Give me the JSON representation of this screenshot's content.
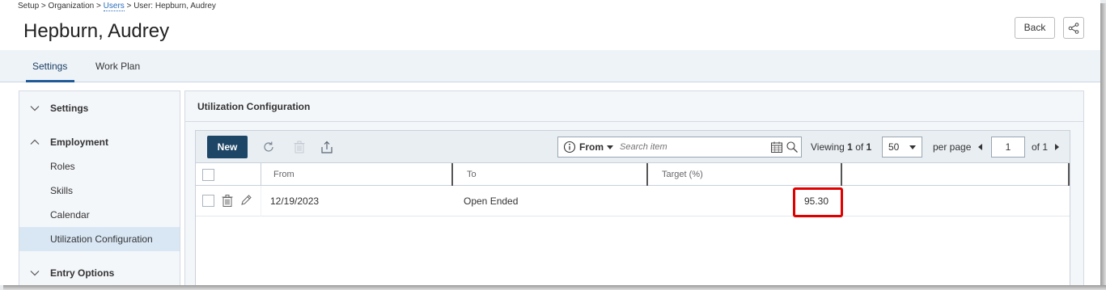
{
  "breadcrumb": {
    "setup": "Setup",
    "sep1": " > ",
    "organization": "Organization",
    "sep2": " > ",
    "users": "Users",
    "sep3": " > ",
    "user": "User: Hepburn, Audrey"
  },
  "page_title": "Hepburn, Audrey",
  "header_actions": {
    "back_label": "Back",
    "share_icon": "share-icon"
  },
  "tabs": [
    {
      "label": "Settings",
      "active": true
    },
    {
      "label": "Work Plan",
      "active": false
    }
  ],
  "sidebar": {
    "sections": [
      {
        "label": "Settings",
        "expanded": false
      },
      {
        "label": "Employment",
        "expanded": true
      },
      {
        "label": "Entry Options",
        "expanded": false
      }
    ],
    "employment_items": [
      {
        "label": "Roles",
        "active": false
      },
      {
        "label": "Skills",
        "active": false
      },
      {
        "label": "Calendar",
        "active": false
      },
      {
        "label": "Utilization Configuration",
        "active": true
      }
    ]
  },
  "panel": {
    "title": "Utilization Configuration"
  },
  "grid": {
    "toolbar": {
      "new_label": "New",
      "search_field": "From",
      "search_placeholder": "Search item",
      "viewing_label": "Viewing",
      "viewing_page": "1",
      "viewing_of": "of",
      "viewing_total": "1",
      "page_size": "50",
      "per_page_label": "per page",
      "current_page": "1",
      "of_pages": "of 1"
    },
    "columns": [
      "From",
      "To",
      "Target (%)"
    ],
    "rows": [
      {
        "from": "12/19/2023",
        "to": "Open Ended",
        "target": "95.30"
      }
    ]
  },
  "colors": {
    "accent": "#1c4566",
    "tab_underline": "#1f5a96",
    "highlight": "#e00000",
    "active_item": "#d9e7f5"
  }
}
